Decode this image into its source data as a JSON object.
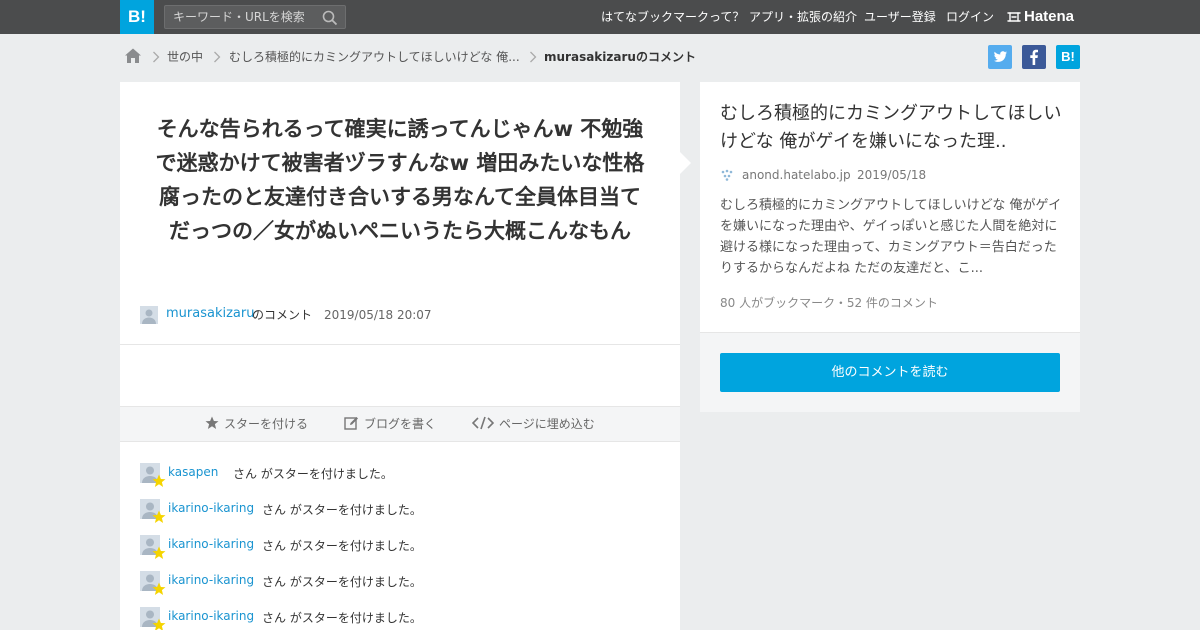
{
  "header": {
    "logo": "B!",
    "search_placeholder": "キーワード・URLを検索",
    "nav": [
      "はてなブックマークって？",
      "アプリ・拡張の紹介",
      "ユーザー登録",
      "ログイン"
    ],
    "brand": "Hatena"
  },
  "breadcrumb": {
    "items": [
      "世の中",
      "むしろ積極的にカミングアウトしてほしいけどな 俺...",
      "murasakizaruのコメント"
    ]
  },
  "share": {
    "twitter": "t",
    "facebook": "f",
    "hatena": "B!"
  },
  "comment": {
    "text": "そんな告られるって確実に誘ってんじゃんw 不勉強で迷惑かけて被害者ヅラすんなw 増田みたいな性格腐ったのと友達付き合いする男なんて全員体目当てだっつの／女がぬいペニいうたら大概こんなもん",
    "user": "murasakizaru",
    "user_suffix": "のコメント",
    "date": "2019/05/18 20:07"
  },
  "actions": {
    "star": "スターを付ける",
    "blog": "ブログを書く",
    "embed": "ページに埋め込む"
  },
  "stars": [
    {
      "user": "kasapen",
      "text": "さん がスターを付けました。"
    },
    {
      "user": "ikarino-ikaring",
      "text": "さん がスターを付けました。"
    },
    {
      "user": "ikarino-ikaring",
      "text": "さん がスターを付けました。"
    },
    {
      "user": "ikarino-ikaring",
      "text": "さん がスターを付けました。"
    },
    {
      "user": "ikarino-ikaring",
      "text": "さん がスターを付けました。"
    }
  ],
  "entry": {
    "title": "むしろ積極的にカミングアウトしてほしいけどな 俺がゲイを嫌いになった理..",
    "domain": "anond.hatelabo.jp",
    "date": "2019/05/18",
    "description": "むしろ積極的にカミングアウトしてほしいけどな 俺がゲイを嫌いになった理由や、ゲイっぽいと感じた人間を絶対に避ける様になった理由って、カミングアウト＝告白だったりするからなんだよね ただの友達だと、こ...",
    "count": "80 人がブックマーク・52 件のコメント",
    "read_more": "他のコメントを読む"
  },
  "colors": {
    "accent": "#00a4de",
    "link": "#1a94d0",
    "header_bg": "#4b4c4d",
    "twitter": "#55acee",
    "facebook": "#3b5998"
  }
}
